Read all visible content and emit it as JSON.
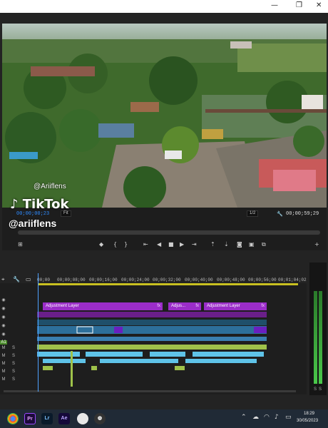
{
  "window": {
    "minimize": "—",
    "maximize": "❐",
    "close": "✕"
  },
  "watermark": {
    "brand": "TikTok",
    "handle_small": "@Ariiflens",
    "handle_large": "@ariiflens"
  },
  "monitor": {
    "timecode_current": "00;00;00;23",
    "fit": "Fit",
    "resolution": "1/2",
    "timecode_duration": "00;00;59;29"
  },
  "timeline": {
    "ruler": [
      "00;00",
      "00;00;08;00",
      "00;00;16;00",
      "00;00;24;00",
      "00;00;32;00",
      "00;00;40;00",
      "00;00;48;00",
      "00;00;56;00",
      "00;01;04;02"
    ],
    "adjustment_layers": [
      {
        "label": "Adjustment Layer",
        "fx": "fx"
      },
      {
        "label": "Adjus...",
        "fx": "fx"
      },
      {
        "label": "Adjustment Layer",
        "fx": "fx"
      }
    ],
    "track_letters": [
      "M",
      "M",
      "M",
      "M",
      "M"
    ],
    "solo_letters": [
      "S",
      "S",
      "S",
      "S",
      "S"
    ],
    "meter_labels": [
      "S",
      "S"
    ]
  },
  "taskbar": {
    "apps": [
      {
        "name": "chrome-icon",
        "label": ""
      },
      {
        "name": "premiere-icon",
        "label": "Pr"
      },
      {
        "name": "lightroom-icon",
        "label": "Lr"
      },
      {
        "name": "after-effects-icon",
        "label": "Ae"
      },
      {
        "name": "paint-icon",
        "label": ""
      },
      {
        "name": "obs-icon",
        "label": ""
      }
    ],
    "time": "18:29",
    "date": "30/05/2023"
  },
  "colors": {
    "accent_blue": "#2f8cff",
    "adjustment_purple": "#9b2dc9",
    "video_clip_blue": "#2d6f9a",
    "audio_clip_green": "#9fc24a",
    "audio_clip_lightblue": "#5fc3e8"
  }
}
